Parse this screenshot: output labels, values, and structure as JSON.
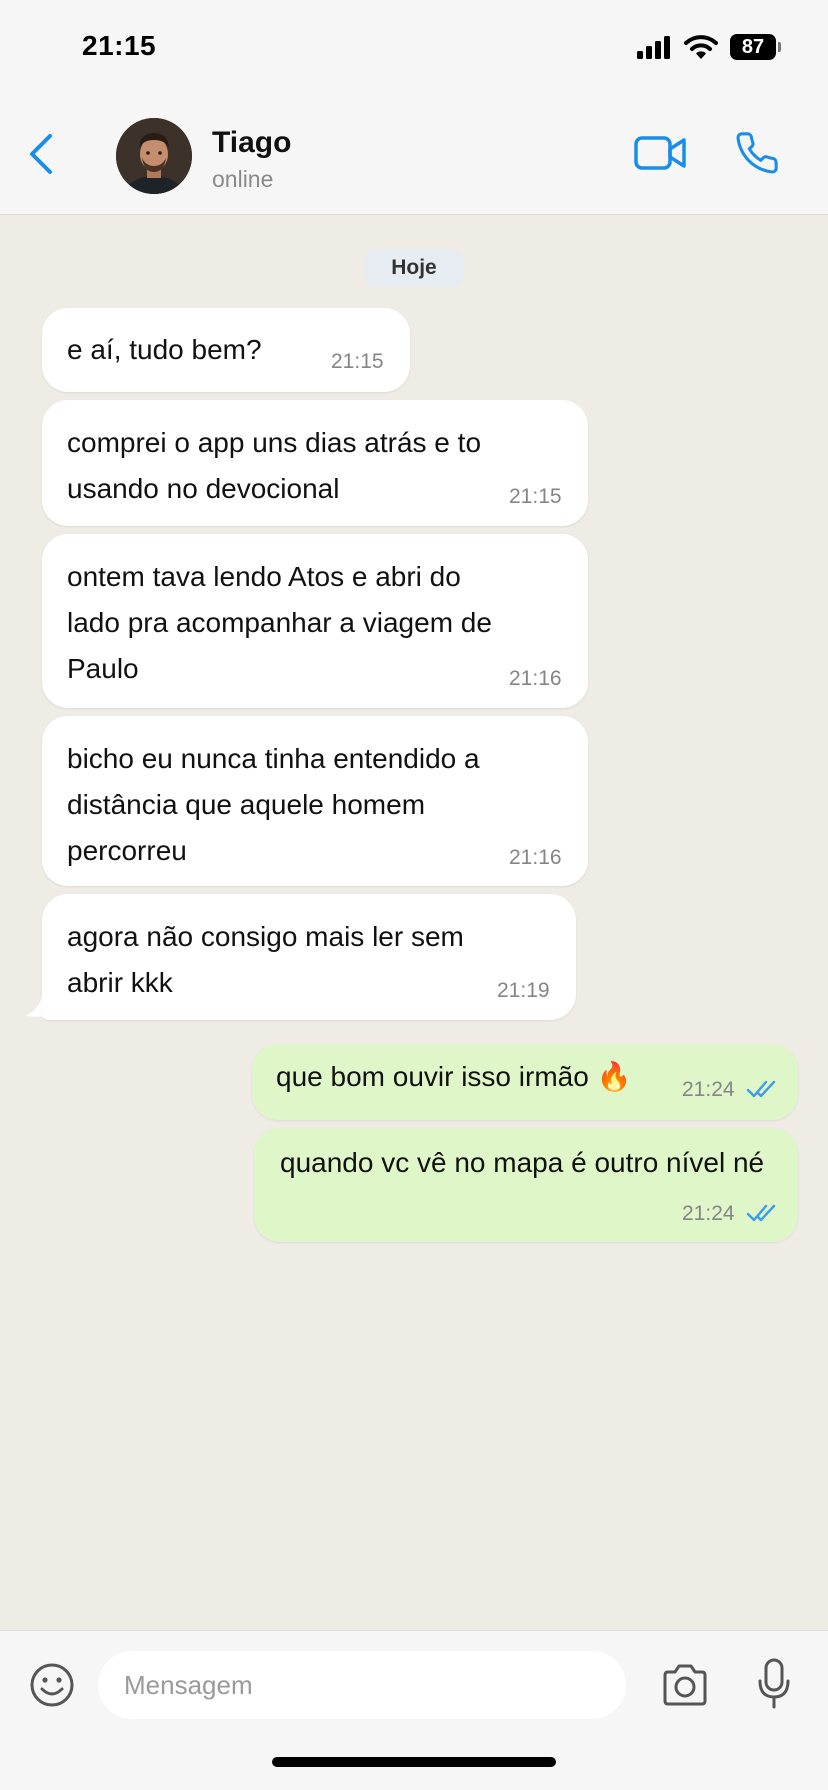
{
  "status_bar": {
    "time": "21:15",
    "battery": "87"
  },
  "header": {
    "contact_name": "Tiago",
    "contact_status": "online"
  },
  "date_chip": "Hoje",
  "messages": [
    {
      "direction": "in",
      "text": "e aí, tudo bem?",
      "time": "21:15"
    },
    {
      "direction": "in",
      "text": "comprei o app uns dias atrás e to\nusando no devocional",
      "time": "21:15"
    },
    {
      "direction": "in",
      "text": "ontem tava lendo Atos e abri do\nlado pra acompanhar a viagem de\nPaulo",
      "time": "21:16"
    },
    {
      "direction": "in",
      "text": "bicho eu nunca tinha entendido a\ndistância que aquele homem\npercorreu",
      "time": "21:16"
    },
    {
      "direction": "in",
      "text": "agora não consigo mais ler sem\nabrir kkk",
      "time": "21:19"
    },
    {
      "direction": "out",
      "text": "que bom ouvir isso irmão 🔥",
      "time": "21:24",
      "read": true
    },
    {
      "direction": "out",
      "text": "quando vc vê no mapa é outro nível né",
      "time": "21:24",
      "read": true
    }
  ],
  "input": {
    "placeholder": "Mensagem"
  },
  "colors": {
    "accent": "#1a8ce9",
    "chat_background": "#efece6",
    "outgoing_bubble": "#dff7c8",
    "incoming_bubble": "#ffffff",
    "read_ticks": "#3d9be9"
  }
}
